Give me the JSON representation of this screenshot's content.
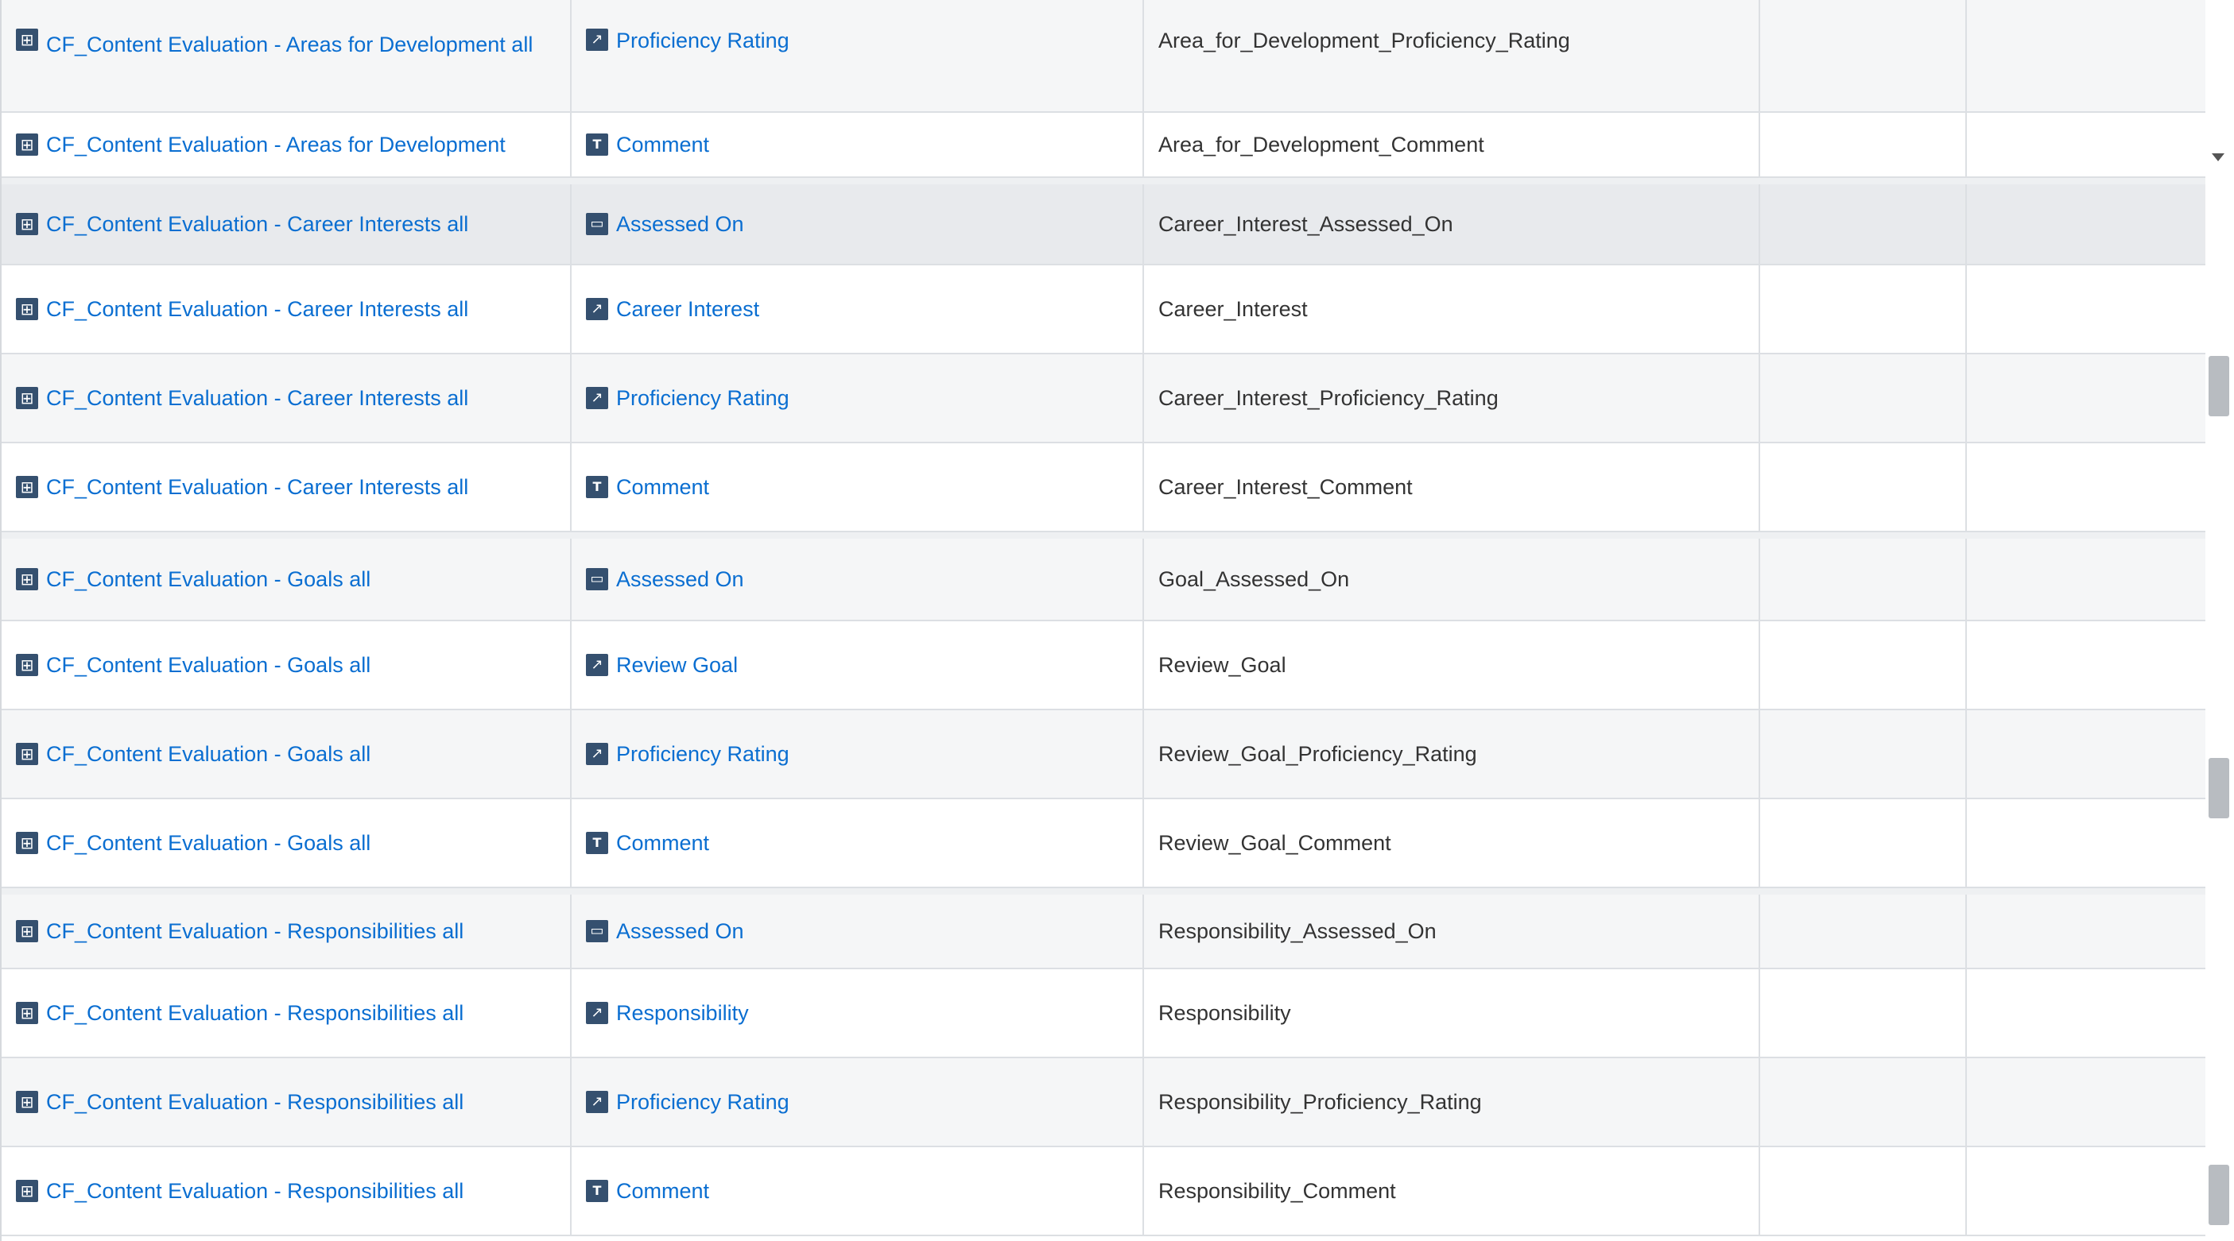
{
  "rows": [
    {
      "entity": "CF_Content Evaluation - Areas for Development all",
      "field": "Proficiency Rating",
      "field_icon": "relation-icon",
      "name": "Area_for_Development_Proficiency_Rating"
    },
    {
      "entity": "CF_Content Evaluation - Areas for Development",
      "field": "Comment",
      "field_icon": "text-icon",
      "name": "Area_for_Development_Comment"
    },
    {
      "entity": "CF_Content Evaluation - Career Interests all",
      "field": "Assessed On",
      "field_icon": "calendar-icon",
      "name": "Career_Interest_Assessed_On"
    },
    {
      "entity": "CF_Content Evaluation - Career Interests all",
      "field": "Career Interest",
      "field_icon": "relation-icon",
      "name": "Career_Interest"
    },
    {
      "entity": "CF_Content Evaluation - Career Interests all",
      "field": "Proficiency Rating",
      "field_icon": "relation-icon",
      "name": "Career_Interest_Proficiency_Rating"
    },
    {
      "entity": "CF_Content Evaluation - Career Interests all",
      "field": "Comment",
      "field_icon": "text-icon",
      "name": "Career_Interest_Comment"
    },
    {
      "entity": "CF_Content Evaluation - Goals all",
      "field": "Assessed On",
      "field_icon": "calendar-icon",
      "name": "Goal_Assessed_On"
    },
    {
      "entity": "CF_Content Evaluation - Goals all",
      "field": "Review Goal",
      "field_icon": "relation-icon",
      "name": "Review_Goal"
    },
    {
      "entity": "CF_Content Evaluation - Goals all",
      "field": "Proficiency Rating",
      "field_icon": "relation-icon",
      "name": "Review_Goal_Proficiency_Rating"
    },
    {
      "entity": "CF_Content Evaluation - Goals all",
      "field": "Comment",
      "field_icon": "text-icon",
      "name": "Review_Goal_Comment"
    },
    {
      "entity": "CF_Content Evaluation - Responsibilities all",
      "field": "Assessed On",
      "field_icon": "calendar-icon",
      "name": "Responsibility_Assessed_On"
    },
    {
      "entity": "CF_Content Evaluation - Responsibilities all",
      "field": "Responsibility",
      "field_icon": "relation-icon",
      "name": "Responsibility"
    },
    {
      "entity": "CF_Content Evaluation - Responsibilities all",
      "field": "Proficiency Rating",
      "field_icon": "relation-icon",
      "name": "Responsibility_Proficiency_Rating"
    },
    {
      "entity": "CF_Content Evaluation - Responsibilities all",
      "field": "Comment",
      "field_icon": "text-icon",
      "name": "Responsibility_Comment"
    }
  ],
  "icons": {
    "entity_icon": "entity-icon"
  },
  "colors": {
    "link": "#0a6ed1",
    "icon_bg": "#35506f",
    "text": "#333333"
  }
}
